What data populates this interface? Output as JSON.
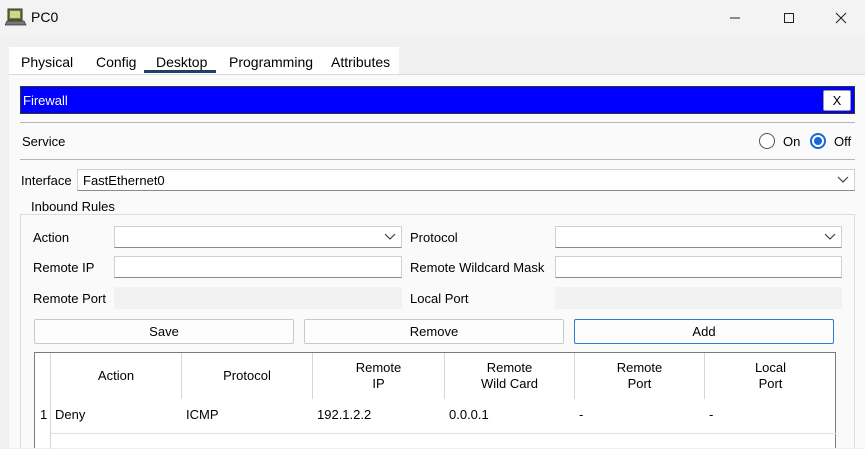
{
  "window": {
    "title": "PC0"
  },
  "tabs": [
    "Physical",
    "Config",
    "Desktop",
    "Programming",
    "Attributes"
  ],
  "firewall": {
    "title": "Firewall",
    "close_label": "X",
    "service_label": "Service",
    "service_on_label": "On",
    "service_off_label": "Off",
    "service_state": "Off",
    "interface_label": "Interface",
    "interface_value": "FastEthernet0",
    "inbound_rules_title": "Inbound Rules",
    "form": {
      "action_label": "Action",
      "action_value": "",
      "protocol_label": "Protocol",
      "protocol_value": "",
      "remote_ip_label": "Remote IP",
      "remote_ip_value": "",
      "remote_wildcard_label": "Remote Wildcard Mask",
      "remote_wildcard_value": "",
      "remote_port_label": "Remote Port",
      "local_port_label": "Local Port"
    },
    "buttons": {
      "save": "Save",
      "remove": "Remove",
      "add": "Add"
    },
    "table": {
      "columns": [
        {
          "line1": "Action",
          "line2": ""
        },
        {
          "line1": "Protocol",
          "line2": ""
        },
        {
          "line1": "Remote",
          "line2": "IP"
        },
        {
          "line1": "Remote",
          "line2": "Wild Card"
        },
        {
          "line1": "Remote",
          "line2": "Port"
        },
        {
          "line1": "Local",
          "line2": "Port"
        }
      ],
      "rows": [
        {
          "index": "1",
          "cells": [
            "Deny",
            "ICMP",
            "192.1.2.2",
            "0.0.0.1",
            "-",
            "-"
          ]
        }
      ]
    }
  },
  "colors": {
    "header_blue": "#0000ff",
    "accent": "#1766d6"
  }
}
